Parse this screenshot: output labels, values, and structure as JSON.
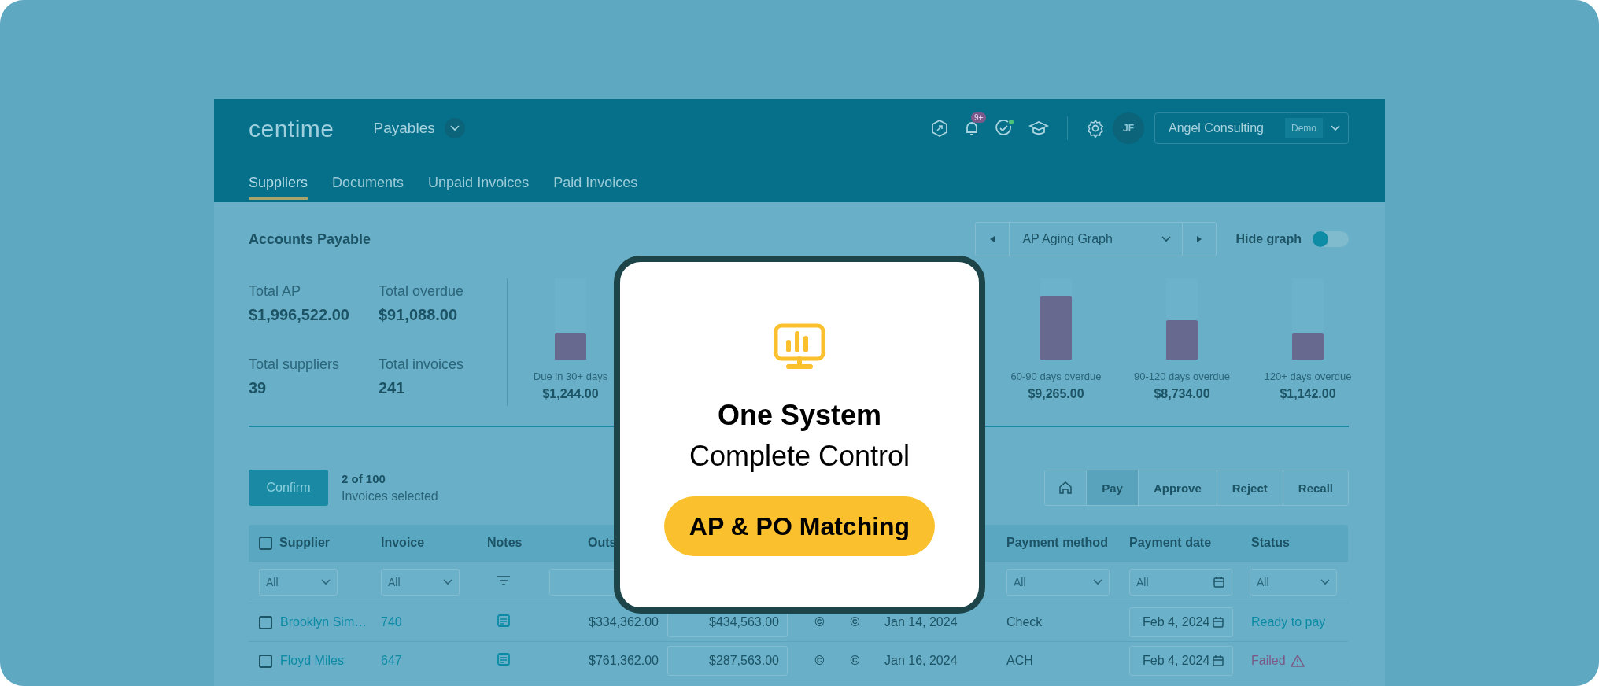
{
  "header": {
    "logo": "centime",
    "module": "Payables",
    "notification_badge": "9+",
    "avatar_initials": "JF",
    "company": "Angel Consulting",
    "company_tag": "Demo"
  },
  "tabs": [
    {
      "label": "Suppliers",
      "selected": true
    },
    {
      "label": "Documents",
      "selected": false
    },
    {
      "label": "Unpaid Invoices",
      "selected": false
    },
    {
      "label": "Paid Invoices",
      "selected": false
    }
  ],
  "section_title": "Accounts Payable",
  "graph_selector": {
    "value": "AP Aging Graph"
  },
  "hide_graph": {
    "label": "Hide graph",
    "on": false
  },
  "stats": [
    {
      "label": "Total AP",
      "value": "$1,996,522.00"
    },
    {
      "label": "Total overdue",
      "value": "$91,088.00"
    },
    {
      "label": "Total suppliers",
      "value": "39"
    },
    {
      "label": "Total invoices",
      "value": "241"
    }
  ],
  "aging_buckets": [
    {
      "label": "Due in 30+ days",
      "amount": "$1,244.00",
      "level": 0.33
    },
    {
      "label": "60-90 days overdue",
      "amount": "$9,265.00",
      "level": 0.79
    },
    {
      "label": "90-120 days overdue",
      "amount": "$8,734.00",
      "level": 0.49
    },
    {
      "label": "120+ days overdue",
      "amount": "$1,142.00",
      "level": 0.33
    }
  ],
  "selection": {
    "button": "Confirm",
    "count": "2 of 100",
    "caption": "Invoices selected"
  },
  "actions": [
    {
      "kind": "icon",
      "selected": false
    },
    {
      "kind": "text",
      "label": "Pay",
      "selected": true
    },
    {
      "kind": "text",
      "label": "Approve",
      "selected": false
    },
    {
      "kind": "text",
      "label": "Reject",
      "selected": false
    },
    {
      "kind": "text",
      "label": "Recall",
      "selected": false
    }
  ],
  "table": {
    "all_checked": false,
    "columns": {
      "supplier": "Supplier",
      "invoice": "Invoice",
      "notes": "Notes",
      "column_4": "Outs",
      "payment_method": "Payment method",
      "payment_date": "Payment date",
      "status": "Status"
    },
    "filters": {
      "supplier": {
        "kind": "select",
        "value": "All"
      },
      "invoice": {
        "kind": "select",
        "value": "All"
      },
      "notes": {
        "kind": "icon"
      },
      "column_4": {
        "kind": "field"
      },
      "payment_method": {
        "kind": "select",
        "value": "All"
      },
      "payment_date": {
        "kind": "date",
        "value": "All"
      },
      "status": {
        "kind": "select",
        "value": "All"
      }
    },
    "rows": [
      {
        "checked": false,
        "supplier": "Brooklyn Sim…",
        "invoice": "740",
        "column_4": "$334,362.00",
        "column_5": "$434,563.00",
        "column_6": "©",
        "column_7": "©",
        "column_8": "Jan 14, 2024",
        "payment_method": "Check",
        "payment_date": "Feb 4, 2024",
        "status": {
          "text": "Ready to pay",
          "kind": "ready"
        }
      },
      {
        "checked": false,
        "supplier": "Floyd Miles",
        "invoice": "647",
        "column_4": "$761,362.00",
        "column_5": "$287,563.00",
        "column_6": "©",
        "column_7": "©",
        "column_8": "Jan 16, 2024",
        "payment_method": "ACH",
        "payment_date": "Feb 4, 2024",
        "status": {
          "text": "Failed",
          "kind": "failed"
        }
      }
    ]
  },
  "promo_card": {
    "title": "One System",
    "subtitle": "Complete Control",
    "badge": "AP & PO Matching"
  }
}
